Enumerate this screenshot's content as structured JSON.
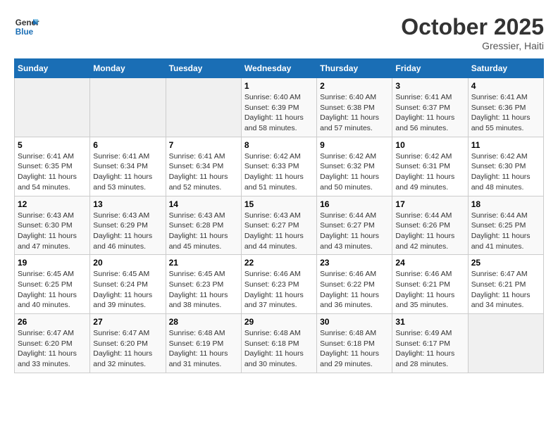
{
  "header": {
    "logo_line1": "General",
    "logo_line2": "Blue",
    "month": "October 2025",
    "location": "Gressier, Haiti"
  },
  "days_of_week": [
    "Sunday",
    "Monday",
    "Tuesday",
    "Wednesday",
    "Thursday",
    "Friday",
    "Saturday"
  ],
  "weeks": [
    [
      {
        "day": "",
        "info": ""
      },
      {
        "day": "",
        "info": ""
      },
      {
        "day": "",
        "info": ""
      },
      {
        "day": "1",
        "info": "Sunrise: 6:40 AM\nSunset: 6:39 PM\nDaylight: 11 hours\nand 58 minutes."
      },
      {
        "day": "2",
        "info": "Sunrise: 6:40 AM\nSunset: 6:38 PM\nDaylight: 11 hours\nand 57 minutes."
      },
      {
        "day": "3",
        "info": "Sunrise: 6:41 AM\nSunset: 6:37 PM\nDaylight: 11 hours\nand 56 minutes."
      },
      {
        "day": "4",
        "info": "Sunrise: 6:41 AM\nSunset: 6:36 PM\nDaylight: 11 hours\nand 55 minutes."
      }
    ],
    [
      {
        "day": "5",
        "info": "Sunrise: 6:41 AM\nSunset: 6:35 PM\nDaylight: 11 hours\nand 54 minutes."
      },
      {
        "day": "6",
        "info": "Sunrise: 6:41 AM\nSunset: 6:34 PM\nDaylight: 11 hours\nand 53 minutes."
      },
      {
        "day": "7",
        "info": "Sunrise: 6:41 AM\nSunset: 6:34 PM\nDaylight: 11 hours\nand 52 minutes."
      },
      {
        "day": "8",
        "info": "Sunrise: 6:42 AM\nSunset: 6:33 PM\nDaylight: 11 hours\nand 51 minutes."
      },
      {
        "day": "9",
        "info": "Sunrise: 6:42 AM\nSunset: 6:32 PM\nDaylight: 11 hours\nand 50 minutes."
      },
      {
        "day": "10",
        "info": "Sunrise: 6:42 AM\nSunset: 6:31 PM\nDaylight: 11 hours\nand 49 minutes."
      },
      {
        "day": "11",
        "info": "Sunrise: 6:42 AM\nSunset: 6:30 PM\nDaylight: 11 hours\nand 48 minutes."
      }
    ],
    [
      {
        "day": "12",
        "info": "Sunrise: 6:43 AM\nSunset: 6:30 PM\nDaylight: 11 hours\nand 47 minutes."
      },
      {
        "day": "13",
        "info": "Sunrise: 6:43 AM\nSunset: 6:29 PM\nDaylight: 11 hours\nand 46 minutes."
      },
      {
        "day": "14",
        "info": "Sunrise: 6:43 AM\nSunset: 6:28 PM\nDaylight: 11 hours\nand 45 minutes."
      },
      {
        "day": "15",
        "info": "Sunrise: 6:43 AM\nSunset: 6:27 PM\nDaylight: 11 hours\nand 44 minutes."
      },
      {
        "day": "16",
        "info": "Sunrise: 6:44 AM\nSunset: 6:27 PM\nDaylight: 11 hours\nand 43 minutes."
      },
      {
        "day": "17",
        "info": "Sunrise: 6:44 AM\nSunset: 6:26 PM\nDaylight: 11 hours\nand 42 minutes."
      },
      {
        "day": "18",
        "info": "Sunrise: 6:44 AM\nSunset: 6:25 PM\nDaylight: 11 hours\nand 41 minutes."
      }
    ],
    [
      {
        "day": "19",
        "info": "Sunrise: 6:45 AM\nSunset: 6:25 PM\nDaylight: 11 hours\nand 40 minutes."
      },
      {
        "day": "20",
        "info": "Sunrise: 6:45 AM\nSunset: 6:24 PM\nDaylight: 11 hours\nand 39 minutes."
      },
      {
        "day": "21",
        "info": "Sunrise: 6:45 AM\nSunset: 6:23 PM\nDaylight: 11 hours\nand 38 minutes."
      },
      {
        "day": "22",
        "info": "Sunrise: 6:46 AM\nSunset: 6:23 PM\nDaylight: 11 hours\nand 37 minutes."
      },
      {
        "day": "23",
        "info": "Sunrise: 6:46 AM\nSunset: 6:22 PM\nDaylight: 11 hours\nand 36 minutes."
      },
      {
        "day": "24",
        "info": "Sunrise: 6:46 AM\nSunset: 6:21 PM\nDaylight: 11 hours\nand 35 minutes."
      },
      {
        "day": "25",
        "info": "Sunrise: 6:47 AM\nSunset: 6:21 PM\nDaylight: 11 hours\nand 34 minutes."
      }
    ],
    [
      {
        "day": "26",
        "info": "Sunrise: 6:47 AM\nSunset: 6:20 PM\nDaylight: 11 hours\nand 33 minutes."
      },
      {
        "day": "27",
        "info": "Sunrise: 6:47 AM\nSunset: 6:20 PM\nDaylight: 11 hours\nand 32 minutes."
      },
      {
        "day": "28",
        "info": "Sunrise: 6:48 AM\nSunset: 6:19 PM\nDaylight: 11 hours\nand 31 minutes."
      },
      {
        "day": "29",
        "info": "Sunrise: 6:48 AM\nSunset: 6:18 PM\nDaylight: 11 hours\nand 30 minutes."
      },
      {
        "day": "30",
        "info": "Sunrise: 6:48 AM\nSunset: 6:18 PM\nDaylight: 11 hours\nand 29 minutes."
      },
      {
        "day": "31",
        "info": "Sunrise: 6:49 AM\nSunset: 6:17 PM\nDaylight: 11 hours\nand 28 minutes."
      },
      {
        "day": "",
        "info": ""
      }
    ]
  ]
}
